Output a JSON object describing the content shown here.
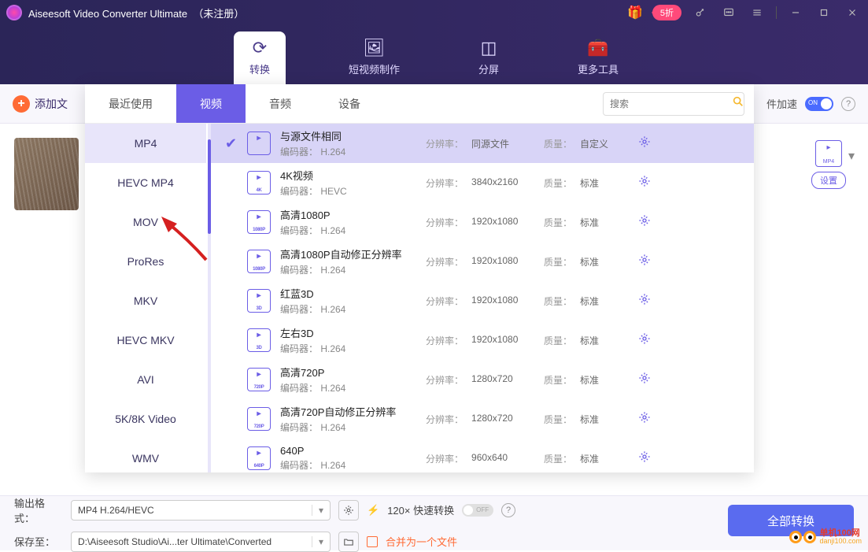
{
  "titlebar": {
    "app_name": "Aiseesoft Video Converter Ultimate",
    "registration": "（未注册）",
    "discount": "5折"
  },
  "header_tabs": {
    "convert": "转换",
    "short_video": "短视频制作",
    "split": "分屏",
    "more_tools": "更多工具"
  },
  "toolbar": {
    "add_file": "添加文",
    "hw_accel": "件加速",
    "on": "ON"
  },
  "dropdown": {
    "tabs": {
      "recent": "最近使用",
      "video": "视频",
      "audio": "音频",
      "device": "设备"
    },
    "search_placeholder": "搜索",
    "formats": [
      "MP4",
      "HEVC MP4",
      "MOV",
      "ProRes",
      "MKV",
      "HEVC MKV",
      "AVI",
      "5K/8K Video",
      "WMV"
    ],
    "labels": {
      "encoder": "编码器：",
      "resolution": "分辨率：",
      "quality": "质量："
    },
    "presets": [
      {
        "title": "与源文件相同",
        "encoder": "H.264",
        "resolution": "同源文件",
        "quality": "自定义",
        "icon": "",
        "selected": true
      },
      {
        "title": "4K视频",
        "encoder": "HEVC",
        "resolution": "3840x2160",
        "quality": "标准",
        "icon": "4K"
      },
      {
        "title": "高清1080P",
        "encoder": "H.264",
        "resolution": "1920x1080",
        "quality": "标准",
        "icon": "1080P"
      },
      {
        "title": "高清1080P自动修正分辨率",
        "encoder": "H.264",
        "resolution": "1920x1080",
        "quality": "标准",
        "icon": "1080P"
      },
      {
        "title": "红蓝3D",
        "encoder": "H.264",
        "resolution": "1920x1080",
        "quality": "标准",
        "icon": "3D"
      },
      {
        "title": "左右3D",
        "encoder": "H.264",
        "resolution": "1920x1080",
        "quality": "标准",
        "icon": "3D"
      },
      {
        "title": "高清720P",
        "encoder": "H.264",
        "resolution": "1280x720",
        "quality": "标准",
        "icon": "720P"
      },
      {
        "title": "高清720P自动修正分辨率",
        "encoder": "H.264",
        "resolution": "1280x720",
        "quality": "标准",
        "icon": "720P"
      },
      {
        "title": "640P",
        "encoder": "H.264",
        "resolution": "960x640",
        "quality": "标准",
        "icon": "640P"
      }
    ]
  },
  "bg": {
    "fmt_badge": "MP4",
    "settings": "设置"
  },
  "footer": {
    "output_format_lbl": "输出格式：",
    "output_format_val": "MP4 H.264/HEVC",
    "save_to_lbl": "保存至：",
    "save_to_val": "D:\\Aiseesoft Studio\\Ai...ter Ultimate\\Converted",
    "fast_convert": "120× 快速转换",
    "off": "OFF",
    "merge": "合并为一个文件",
    "convert_all": "全部转换"
  },
  "watermark": {
    "l1": "单机100网",
    "l2": "danji100.com"
  }
}
